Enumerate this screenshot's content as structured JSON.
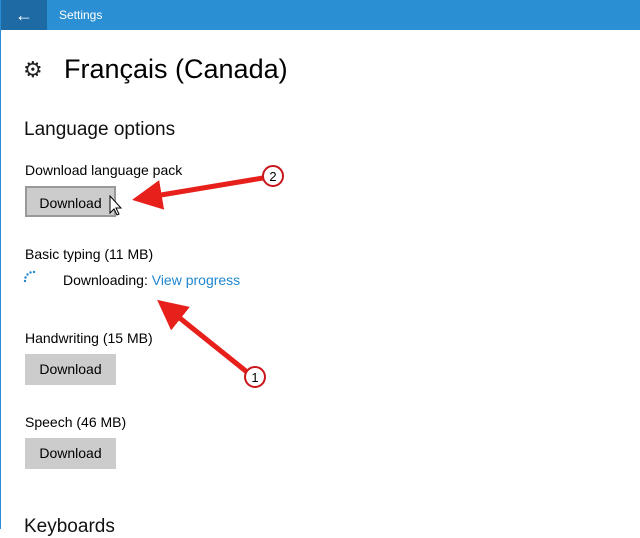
{
  "titlebar": {
    "title": "Settings",
    "back_icon": "back-arrow-icon"
  },
  "page": {
    "title": "Français (Canada)",
    "icon": "gear-icon"
  },
  "language_options": {
    "heading": "Language options",
    "language_pack": {
      "label": "Download language pack",
      "button": "Download"
    },
    "basic_typing": {
      "label": "Basic typing (11 MB)",
      "status": "Downloading:",
      "link": "View progress"
    },
    "handwriting": {
      "label": "Handwriting (15 MB)",
      "button": "Download"
    },
    "speech": {
      "label": "Speech (46 MB)",
      "button": "Download"
    }
  },
  "keyboards": {
    "heading": "Keyboards"
  },
  "annotations": {
    "callout_1": "1",
    "callout_2": "2",
    "color": "#e8201c"
  }
}
